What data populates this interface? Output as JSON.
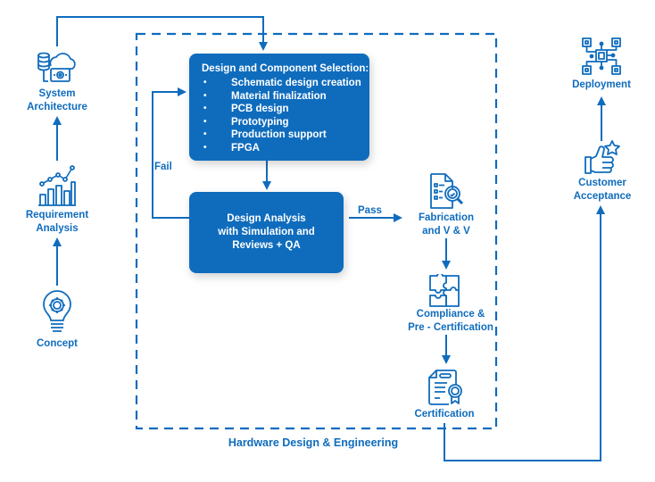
{
  "diagram": {
    "title": "Hardware Design & Engineering",
    "accent_color": "#0f6cbd",
    "box_text_color": "#ffffff",
    "left_column": [
      {
        "id": "system-architecture",
        "label_lines": [
          "System",
          "Architecture"
        ],
        "icon": "cloud-database-computer-icon"
      },
      {
        "id": "requirement-analysis",
        "label_lines": [
          "Requirement",
          "Analysis"
        ],
        "icon": "bar-chart-growth-icon"
      },
      {
        "id": "concept",
        "label_lines": [
          "Concept"
        ],
        "icon": "lightbulb-gear-icon"
      }
    ],
    "design_box": {
      "title": "Design and Component Selection:",
      "items": [
        "Schematic design creation",
        "Material finalization",
        "PCB design",
        "Prototyping",
        "Production support",
        "FPGA"
      ]
    },
    "analysis_box": {
      "label_lines": [
        "Design Analysis",
        "with Simulation and",
        "Reviews + QA"
      ]
    },
    "edge_labels": {
      "fail": "Fail",
      "pass": "Pass"
    },
    "right_inner_column": [
      {
        "id": "fabrication",
        "label_lines": [
          "Fabrication",
          "and V & V"
        ],
        "icon": "document-magnifier-icon"
      },
      {
        "id": "compliance",
        "label_lines": [
          "Compliance &",
          "Pre - Certification"
        ],
        "icon": "puzzle-icon"
      },
      {
        "id": "certification",
        "label_lines": [
          "Certification"
        ],
        "icon": "certificate-icon"
      }
    ],
    "far_right_column": [
      {
        "id": "deployment",
        "label_lines": [
          "Deployment"
        ],
        "icon": "circuit-chip-icon"
      },
      {
        "id": "customer-acceptance",
        "label_lines": [
          "Customer",
          "Acceptance"
        ],
        "icon": "thumbs-up-star-icon"
      }
    ]
  }
}
